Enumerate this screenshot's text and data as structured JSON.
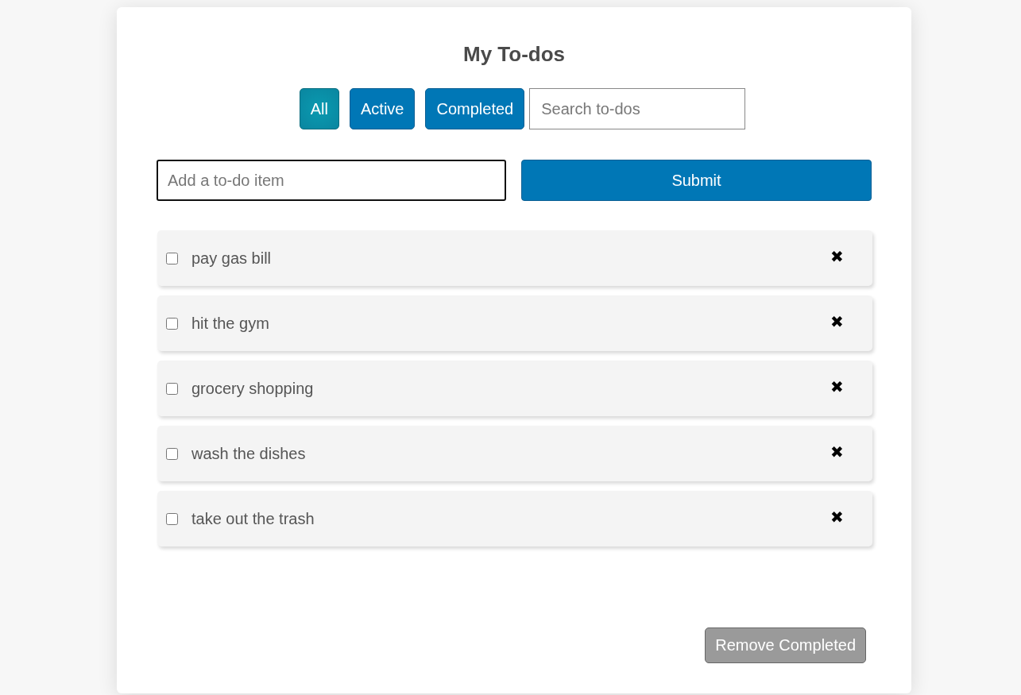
{
  "title": "My To-dos",
  "filters": [
    {
      "label": "All",
      "selected": true
    },
    {
      "label": "Active",
      "selected": false
    },
    {
      "label": "Completed",
      "selected": false
    }
  ],
  "search": {
    "placeholder": "Search to-dos"
  },
  "new_item": {
    "placeholder": "Add a to-do item"
  },
  "submit_button": "Submit",
  "todos": [
    {
      "text": "pay gas bill",
      "checked": false,
      "delete": "✖"
    },
    {
      "text": "hit the gym",
      "checked": false,
      "delete": "✖"
    },
    {
      "text": "grocery shopping",
      "checked": false,
      "delete": "✖"
    },
    {
      "text": "wash the dishes",
      "checked": false,
      "delete": "✖"
    },
    {
      "text": "take out the trash",
      "checked": false,
      "delete": "✖"
    }
  ],
  "remove_completed": {
    "label": "Remove Completed",
    "disabled": true
  }
}
